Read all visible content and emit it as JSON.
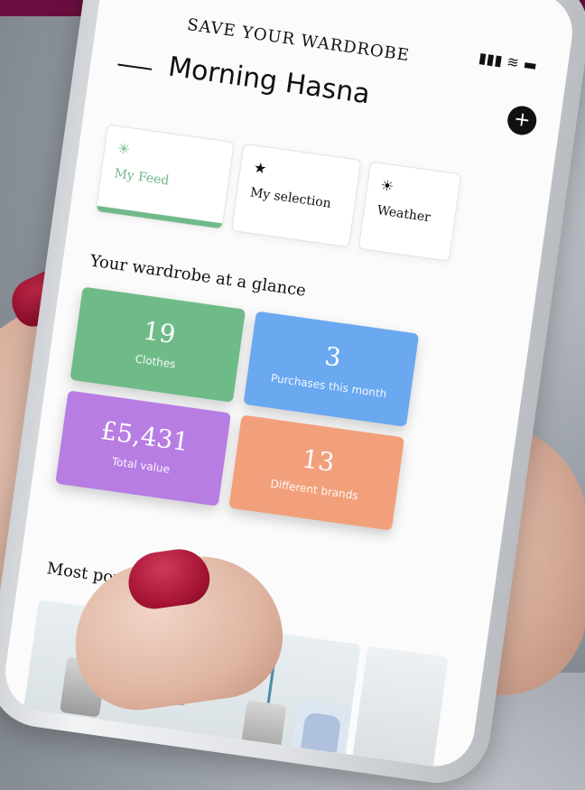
{
  "app": {
    "title": "SAVE YOUR WARDROBE",
    "greeting": "Morning Hasna",
    "add_icon": "+",
    "status_icons": "signal-wifi-battery"
  },
  "tabs": [
    {
      "label": "My Feed",
      "icon": "sparkle-icon",
      "active": true
    },
    {
      "label": "My selection",
      "icon": "star-icon",
      "active": false
    },
    {
      "label": "Weather",
      "icon": "sun-icon",
      "active": false
    }
  ],
  "sections": {
    "glance_title": "Your wardrobe at a glance",
    "popular_title": "Most popular clothes"
  },
  "glance_cards": [
    {
      "value": "19",
      "caption": "Clothes"
    },
    {
      "value": "3",
      "caption": "Purchases this month"
    },
    {
      "value": "£5,431",
      "caption": "Total value"
    },
    {
      "value": "13",
      "caption": "Different brands"
    }
  ],
  "colors": {
    "accent_green": "#70b98a",
    "card_green": "#6fbb88",
    "card_blue": "#6aa8f0",
    "card_purple": "#b77de3",
    "card_orange": "#f2a07b",
    "top_bar": "#6b0e3f"
  }
}
